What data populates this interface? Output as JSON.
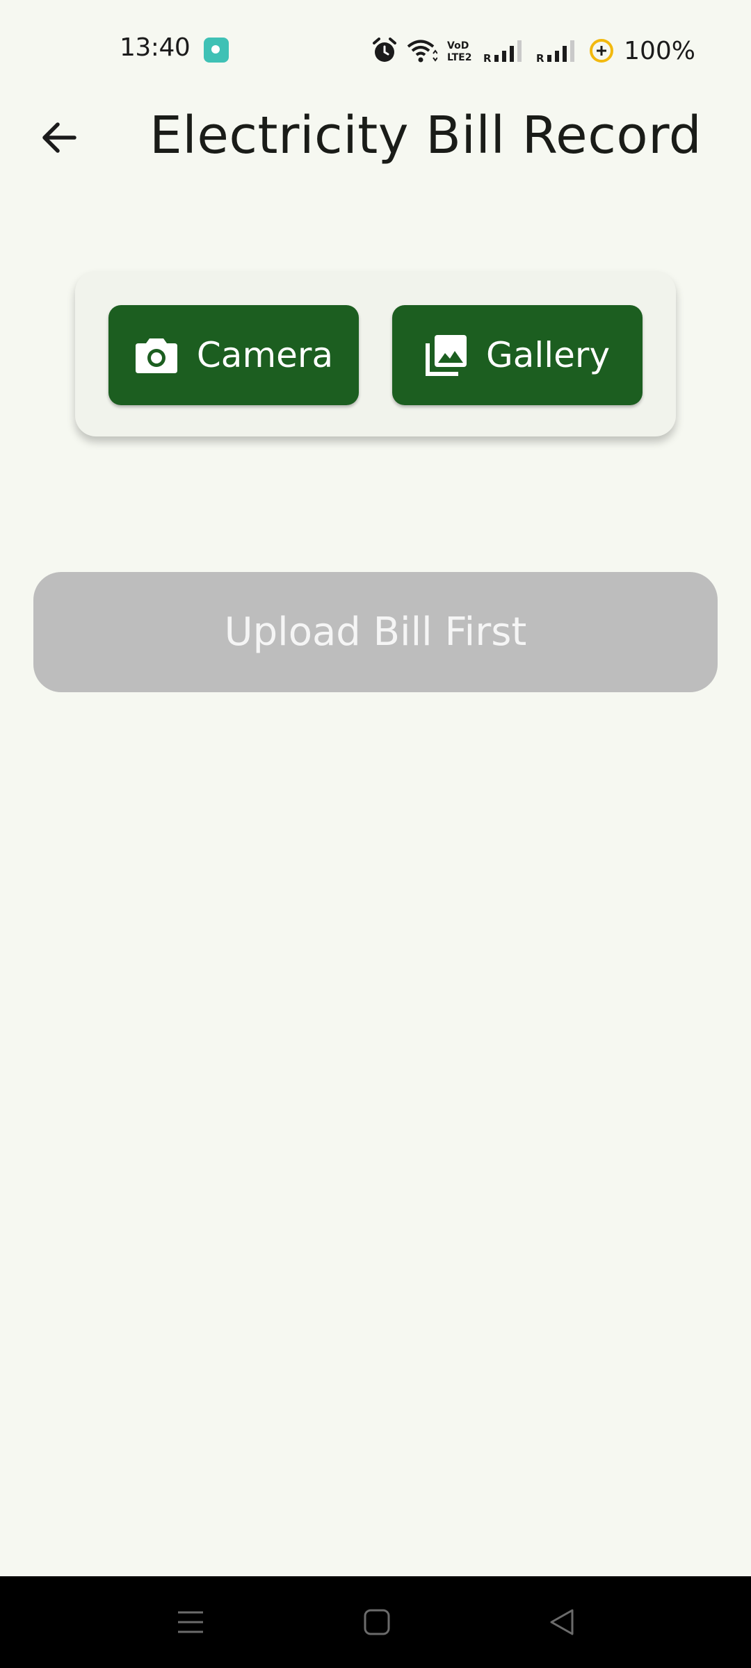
{
  "status_bar": {
    "time": "13:40",
    "battery": "100%",
    "icons": [
      "notification-app-icon",
      "alarm-icon",
      "wifi-icon",
      "volte-icon",
      "signal-icon",
      "signal-icon",
      "battery-saver-icon"
    ]
  },
  "header": {
    "title": "Electricity Bill Record",
    "back_icon": "arrow-left-icon"
  },
  "picker": {
    "camera_label": "Camera",
    "camera_icon": "camera-icon",
    "gallery_label": "Gallery",
    "gallery_icon": "photo-library-icon"
  },
  "upload_button": {
    "label": "Upload Bill First",
    "enabled": false
  },
  "nav_bar": {
    "icons": [
      "menu-icon",
      "home-icon",
      "back-icon"
    ]
  },
  "colors": {
    "background": "#f6f8f1",
    "primary": "#1c5e20",
    "card": "#f1f3ec",
    "disabled": "#bdbdbd"
  }
}
